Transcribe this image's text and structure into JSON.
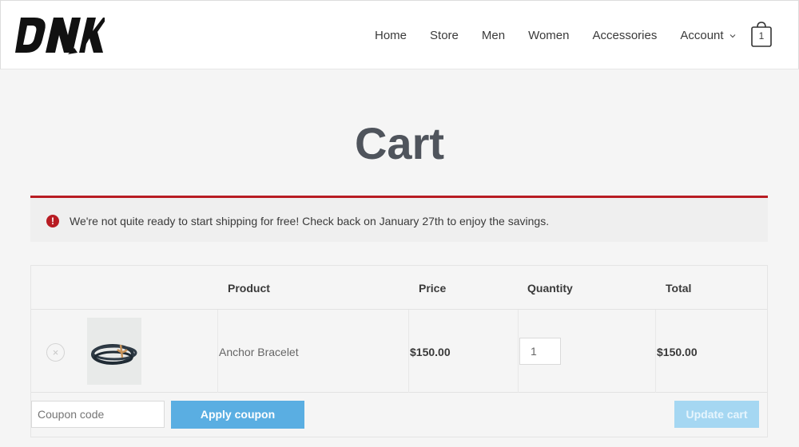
{
  "header": {
    "logo_text": "DNK",
    "nav": [
      {
        "label": "Home"
      },
      {
        "label": "Store"
      },
      {
        "label": "Men"
      },
      {
        "label": "Women"
      },
      {
        "label": "Accessories"
      },
      {
        "label": "Account"
      }
    ],
    "cart_count": "1"
  },
  "page": {
    "title": "Cart"
  },
  "notice": {
    "text": "We're not quite ready to start shipping for free! Check back on January 27th to enjoy the savings.",
    "icon": "!"
  },
  "cart": {
    "columns": [
      "Product",
      "Price",
      "Quantity",
      "Total"
    ],
    "items": [
      {
        "name": "Anchor Bracelet",
        "price": "$150.00",
        "quantity": "1",
        "total": "$150.00",
        "remove": "×"
      }
    ],
    "coupon_placeholder": "Coupon code",
    "apply_label": "Apply coupon",
    "update_label": "Update cart"
  },
  "colors": {
    "accent": "#5aaee2",
    "error": "#b81c23"
  }
}
